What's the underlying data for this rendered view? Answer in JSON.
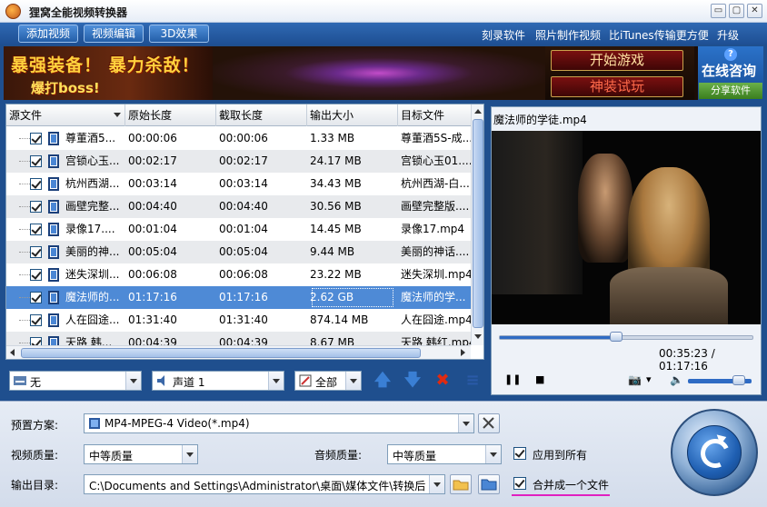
{
  "window": {
    "title": "狸窝全能视频转换器",
    "controls": [
      "▭",
      "▢",
      "✕"
    ]
  },
  "toolbar": {
    "add_video": "添加视频",
    "edit_video": "视频编辑",
    "effect_3d": "3D效果",
    "links": [
      "刻录软件",
      "照片制作视频",
      "比iTunes传输更方便",
      "升级"
    ]
  },
  "banner": {
    "headline": "暴强装备！ 暴力杀敌！",
    "subline": "爆打boss!",
    "start_game": "开始游戏",
    "try_gear": "神装试玩",
    "consult": "在线咨询",
    "share": "分享软件",
    "help_icon": "?"
  },
  "file_list": {
    "columns": [
      "源文件",
      "原始长度",
      "截取长度",
      "输出大小",
      "目标文件"
    ],
    "rows": [
      {
        "name": "尊董酒5...",
        "orig": "00:00:06",
        "cut": "00:00:06",
        "size": "1.33 MB",
        "target": "尊董酒5S-成..."
      },
      {
        "name": "宫锁心玉...",
        "orig": "00:02:17",
        "cut": "00:02:17",
        "size": "24.17 MB",
        "target": "宫锁心玉01...."
      },
      {
        "name": "杭州西湖...",
        "orig": "00:03:14",
        "cut": "00:03:14",
        "size": "34.43 MB",
        "target": "杭州西湖-白..."
      },
      {
        "name": "画壁完整...",
        "orig": "00:04:40",
        "cut": "00:04:40",
        "size": "30.56 MB",
        "target": "画壁完整版...."
      },
      {
        "name": "录像17....",
        "orig": "00:01:04",
        "cut": "00:01:04",
        "size": "14.45 MB",
        "target": "录像17.mp4"
      },
      {
        "name": "美丽的神...",
        "orig": "00:05:04",
        "cut": "00:05:04",
        "size": "9.44 MB",
        "target": "美丽的神话...."
      },
      {
        "name": "迷失深圳...",
        "orig": "00:06:08",
        "cut": "00:06:08",
        "size": "23.22 MB",
        "target": "迷失深圳.mp4"
      },
      {
        "name": "魔法师的...",
        "orig": "01:17:16",
        "cut": "01:17:16",
        "size": "2.62 GB",
        "target": "魔法师的学..."
      },
      {
        "name": "人在囧途...",
        "orig": "01:31:40",
        "cut": "01:31:40",
        "size": "874.14 MB",
        "target": "人在囧途.mp4"
      },
      {
        "name": "天路 韩...",
        "orig": "00:04:39",
        "cut": "00:04:39",
        "size": "8.67 MB",
        "target": "天路 韩红.mp4"
      }
    ],
    "selected_index": 7
  },
  "list_controls": {
    "subtitle": "无",
    "audio_track": "声道 1",
    "filter": "全部",
    "move_up": "🡅",
    "move_down": "🡇",
    "delete": "✖",
    "clear": "≡"
  },
  "preview": {
    "filename": "魔法师的学徒.mp4",
    "time": "00:35:23 / 01:17:16",
    "progress": 0.46,
    "volume": 0.8,
    "pause": "❚❚",
    "stop": "■",
    "snapshot": "📷",
    "snapshot_drop": "▾",
    "speaker": "🔈"
  },
  "settings": {
    "preset_label": "预置方案:",
    "preset_value": "MP4-MPEG-4 Video(*.mp4)",
    "video_quality_label": "视频质量:",
    "video_quality_value": "中等质量",
    "audio_quality_label": "音频质量:",
    "audio_quality_value": "中等质量",
    "apply_all": "应用到所有",
    "output_label": "输出目录:",
    "output_path": "C:\\Documents and Settings\\Administrator\\桌面\\媒体文件\\转换后",
    "merge": "合并成一个文件"
  },
  "colors": {
    "accent": "#2e6bc4",
    "selected_row": "#4e8ad6",
    "merge_underline": "#e020c0"
  }
}
